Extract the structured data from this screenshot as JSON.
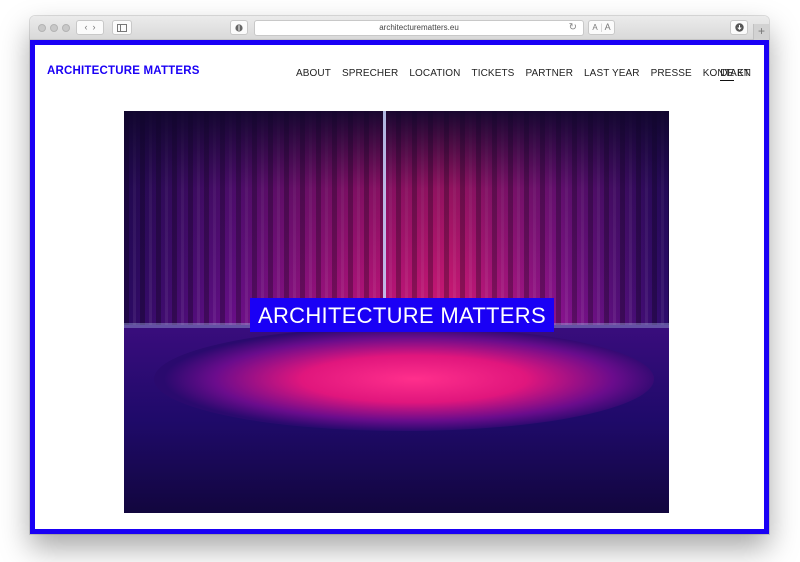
{
  "browser": {
    "url": "architecturematters.eu",
    "text_size_small": "A",
    "text_size_large": "A",
    "new_tab": "+"
  },
  "site": {
    "logo": "ARCHITECTURE MATTERS",
    "brand_color": "#1a00f5",
    "nav": [
      "ABOUT",
      "SPRECHER",
      "LOCATION",
      "TICKETS",
      "PARTNER",
      "LAST YEAR",
      "PRESSE",
      "KONTAKT"
    ],
    "languages": [
      "DE",
      "EN"
    ],
    "active_language": "DE"
  },
  "hero": {
    "title": "ARCHITECTURE MATTERS",
    "image": "stage-curtain-magenta-light"
  }
}
